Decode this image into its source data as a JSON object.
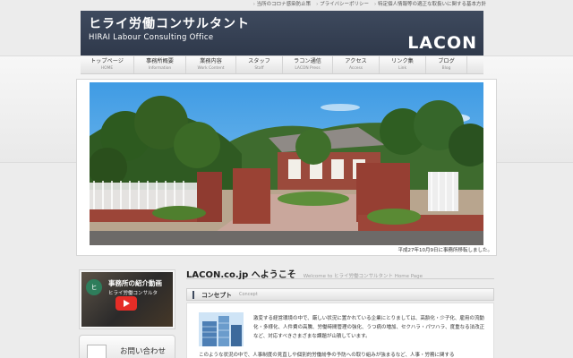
{
  "toplinks": [
    "当所のコロナ感染防止策",
    "プライバシーポリシー",
    "特定個人情報等の適正な取扱いに関する基本方針"
  ],
  "header": {
    "title": "ヒライ労働コンサルタント",
    "subtitle": "HIRAI Labour Consulting Office",
    "logo": "LACON"
  },
  "nav": [
    {
      "jp": "トップページ",
      "en": "HOME"
    },
    {
      "jp": "事務所概要",
      "en": "Information"
    },
    {
      "jp": "業務内容",
      "en": "Work Content"
    },
    {
      "jp": "スタッフ",
      "en": "Staff"
    },
    {
      "jp": "ラコン通信",
      "en": "LACON Press"
    },
    {
      "jp": "アクセス",
      "en": "Access"
    },
    {
      "jp": "リンク集",
      "en": "Link"
    },
    {
      "jp": "ブログ",
      "en": "Blog"
    }
  ],
  "hero": {
    "caption": "平成27年10月9日に事務所移転しました。"
  },
  "sidebar": {
    "video_title": "事務所の紹介動画",
    "video_sub": "ヒライ労働コンサルタ",
    "video_avatar": "ヒ",
    "inquiry": "お問い合わせ"
  },
  "main": {
    "welcome_title": "LACON.co.jp へようこそ",
    "welcome_sub": "Welcome to ヒライ労働コンサルタント Home Page",
    "concept_title": "コンセプト",
    "concept_sub": "Concept",
    "para1": "激変する経営環境の中で、厳しい状況に置かれている企業にとりましては、高齢化・少子化、雇用の流動化・多様化、人件費の高騰、労働時間管理の強化、うつ病の増加、セクハラ・パワハラ、度重なる法改正など、対応すべきさまざまな課題が山積しています。",
    "para2": "このような状況の中で、人事制度の見直しや個別的労働紛争の予防への取り組みが強まるなど、人事・労務に関する"
  },
  "colors": {
    "header_bg": "#3e4a5e",
    "sky": "#4fa6e6",
    "youtube_red": "#e52d27"
  }
}
